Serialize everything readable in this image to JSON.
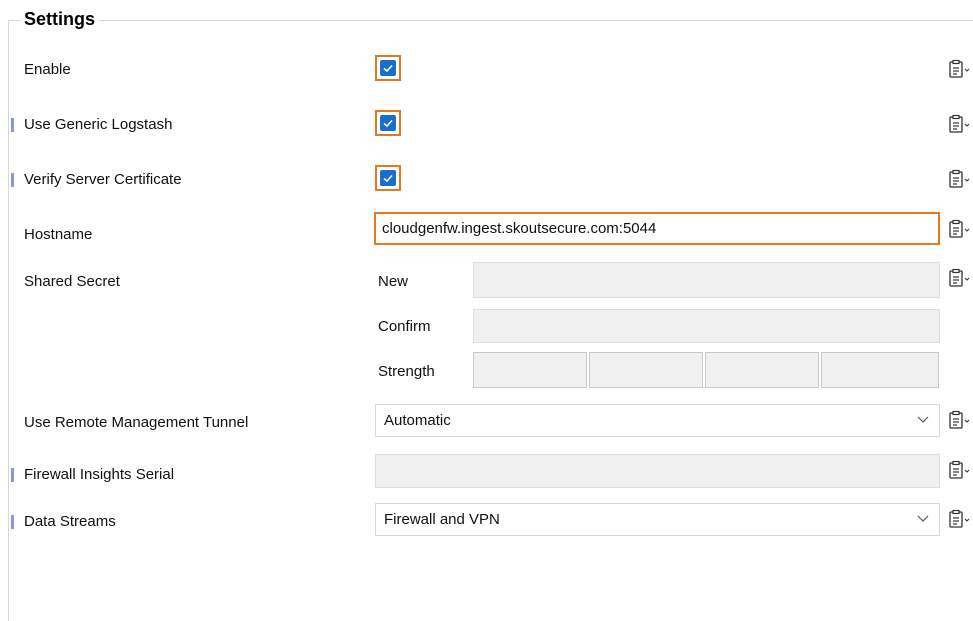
{
  "group": {
    "title": "Settings"
  },
  "rows": {
    "enable": {
      "label": "Enable",
      "checked": true
    },
    "generic_logstash": {
      "label": "Use Generic Logstash",
      "checked": true
    },
    "verify_cert": {
      "label": "Verify Server Certificate",
      "checked": true
    },
    "hostname": {
      "label": "Hostname",
      "value": "cloudgenfw.ingest.skoutsecure.com:5044"
    },
    "shared_secret": {
      "label": "Shared Secret",
      "new_label": "New",
      "confirm_label": "Confirm",
      "strength_label": "Strength"
    },
    "remote_tunnel": {
      "label": "Use Remote Management Tunnel",
      "value": "Automatic"
    },
    "insights_serial": {
      "label": "Firewall Insights Serial",
      "value": ""
    },
    "data_streams": {
      "label": "Data Streams",
      "value": "Firewall and VPN"
    }
  },
  "icons": {
    "clipboard": "clipboard-menu-icon",
    "check": "checkmark-icon",
    "dropdown": "chevron-down-icon"
  },
  "colors": {
    "focus_border": "#e4791f",
    "checkbox_fill": "#1a6fce",
    "marker": "#8a97d6",
    "disabled_bg": "#f0f0f0"
  }
}
